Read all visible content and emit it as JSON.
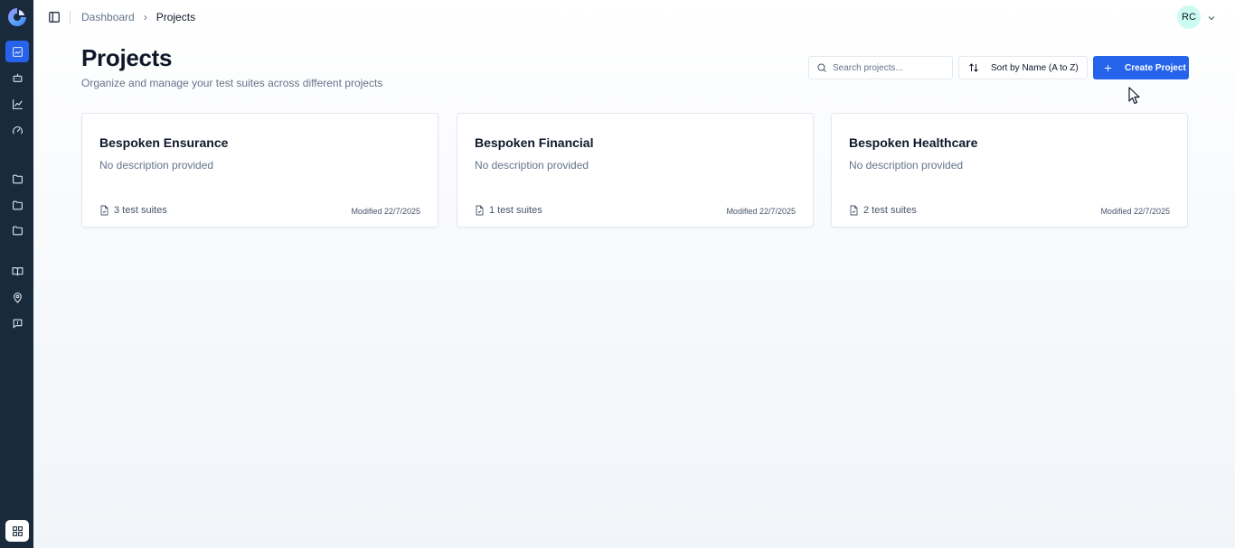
{
  "sidebar": {
    "logo": "app-logo",
    "items": [
      {
        "name": "sidebar-item-dashboard",
        "icon": "image-icon",
        "active": true
      },
      {
        "name": "sidebar-item-bots",
        "icon": "robot-icon",
        "active": false
      },
      {
        "name": "sidebar-item-analytics",
        "icon": "line-chart-icon",
        "active": false
      },
      {
        "name": "sidebar-item-performance",
        "icon": "gauge-icon",
        "active": false
      },
      {
        "name": "sidebar-item-folder-1",
        "icon": "folder-icon",
        "active": false
      },
      {
        "name": "sidebar-item-folder-2",
        "icon": "folder-icon",
        "active": false
      },
      {
        "name": "sidebar-item-folder-3",
        "icon": "folder-icon",
        "active": false
      },
      {
        "name": "sidebar-item-docs",
        "icon": "book-icon",
        "active": false
      },
      {
        "name": "sidebar-item-locations",
        "icon": "map-pin-icon",
        "active": false
      },
      {
        "name": "sidebar-item-feedback",
        "icon": "message-icon",
        "active": false
      }
    ],
    "bottom_icon": "grid-icon"
  },
  "topbar": {
    "breadcrumb": {
      "home": "Dashboard",
      "separator": "›",
      "current": "Projects"
    },
    "avatar_initials": "RC"
  },
  "header": {
    "title": "Projects",
    "subtitle": "Organize and manage your test suites across different projects"
  },
  "toolbar": {
    "search_placeholder": "Search projects...",
    "search_value": "",
    "sort_label": "Sort by Name (A to Z)",
    "create_label": "Create Project"
  },
  "projects": [
    {
      "name": "Bespoken Ensurance",
      "description": "No description provided",
      "suites": "3 test suites",
      "modified": "Modified 22/7/2025"
    },
    {
      "name": "Bespoken Financial",
      "description": "No description provided",
      "suites": "1 test suites",
      "modified": "Modified 22/7/2025"
    },
    {
      "name": "Bespoken Healthcare",
      "description": "No description provided",
      "suites": "2 test suites",
      "modified": "Modified 22/7/2025"
    }
  ],
  "colors": {
    "sidebar_bg": "#1a2a3d",
    "accent": "#2563eb",
    "avatar_bg": "#ccfbf1"
  }
}
